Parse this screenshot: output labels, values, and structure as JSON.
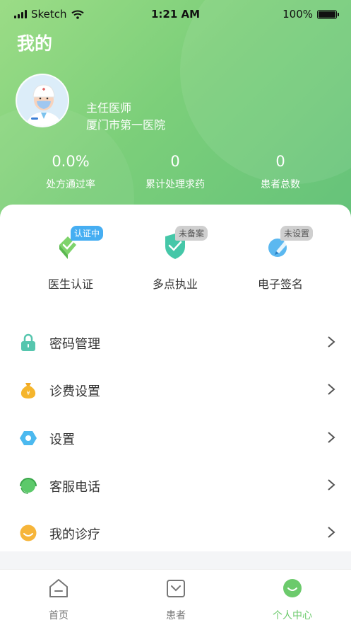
{
  "status_bar": {
    "carrier": "Sketch",
    "time": "1:21 AM",
    "battery": "100%"
  },
  "header": {
    "title": "我的"
  },
  "profile": {
    "role": "主任医师",
    "hospital": "厦门市第一医院"
  },
  "stats": [
    {
      "value": "0.0%",
      "label": "处方通过率"
    },
    {
      "value": "0",
      "label": "累计处理求药"
    },
    {
      "value": "0",
      "label": "患者总数"
    }
  ],
  "certs": [
    {
      "label": "医生认证",
      "badge": "认证中",
      "icon": "shield-check-icon"
    },
    {
      "label": "多点执业",
      "badge": "未备案",
      "icon": "shield-check-icon"
    },
    {
      "label": "电子签名",
      "badge": "未设置",
      "icon": "pen-icon"
    }
  ],
  "menu": [
    {
      "label": "密码管理",
      "icon": "lock-icon"
    },
    {
      "label": "诊费设置",
      "icon": "money-bag-icon"
    },
    {
      "label": "设置",
      "icon": "hexagon-settings-icon"
    },
    {
      "label": "客服电话",
      "icon": "headset-icon"
    },
    {
      "label": "我的诊疗",
      "icon": "smile-icon"
    }
  ],
  "tabs": [
    {
      "label": "首页",
      "icon": "home-icon"
    },
    {
      "label": "患者",
      "icon": "patient-icon"
    },
    {
      "label": "个人中心",
      "icon": "profile-smile-icon"
    }
  ],
  "colors": {
    "brand_green": "#6cca6c",
    "badge_blue": "#46aef2",
    "badge_gray": "#cfcfcf"
  }
}
